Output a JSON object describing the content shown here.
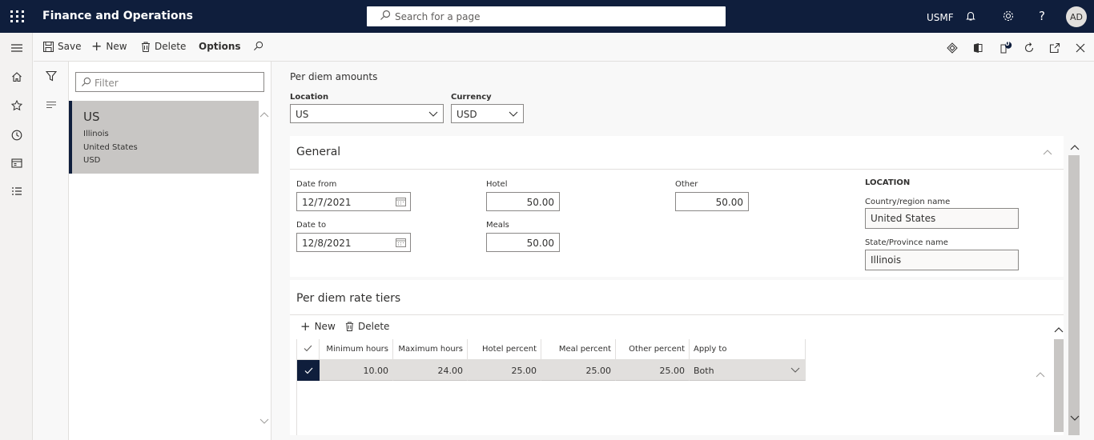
{
  "topbar": {
    "app_name": "Finance and Operations",
    "search_placeholder": "Search for a page",
    "company": "USMF",
    "user_initials": "AD"
  },
  "actions": {
    "save": "Save",
    "new": "New",
    "delete": "Delete",
    "options": "Options",
    "notification_count": "0"
  },
  "list": {
    "filter_placeholder": "Filter",
    "items": [
      {
        "code": "US",
        "state": "Illinois",
        "country": "United States",
        "currency": "USD"
      }
    ]
  },
  "form": {
    "page_title": "Per diem amounts",
    "location_label": "Location",
    "location_value": "US",
    "currency_label": "Currency",
    "currency_value": "USD"
  },
  "general": {
    "header": "General",
    "date_from_label": "Date from",
    "date_from": "12/7/2021",
    "date_to_label": "Date to",
    "date_to": "12/8/2021",
    "hotel_label": "Hotel",
    "hotel": "50.00",
    "meals_label": "Meals",
    "meals": "50.00",
    "other_label": "Other",
    "other": "50.00",
    "location_group": "LOCATION",
    "country_label": "Country/region name",
    "country": "United States",
    "state_label": "State/Province name",
    "state": "Illinois"
  },
  "tiers": {
    "header": "Per diem rate tiers",
    "new": "New",
    "delete": "Delete",
    "columns": [
      "Minimum hours",
      "Maximum hours",
      "Hotel percent",
      "Meal percent",
      "Other percent",
      "Apply to"
    ],
    "rows": [
      {
        "min": "10.00",
        "max": "24.00",
        "hotel": "25.00",
        "meal": "25.00",
        "other": "25.00",
        "apply": "Both"
      }
    ]
  }
}
